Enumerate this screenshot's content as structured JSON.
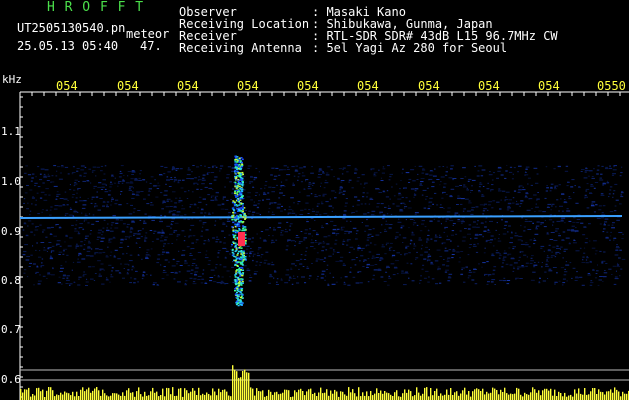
{
  "header": {
    "brand": "H R O F F T",
    "filename": "UT2505130540.pn",
    "tag": "meteor",
    "date": "25.05.13 05:40",
    "count": "47.",
    "fields": [
      {
        "label": "Observer",
        "value": ": Masaki Kano"
      },
      {
        "label": "Receiving Location",
        "value": ": Shibukawa, Gunma, Japan"
      },
      {
        "label": "Receiver",
        "value": ": RTL-SDR SDR# 43dB L15 96.7MHz CW"
      },
      {
        "label": "Receiving Antenna",
        "value": ": 5el Yagi Az 280 for Seoul"
      }
    ]
  },
  "axis": {
    "unit": "kHz",
    "y_ticks": [
      "1.1",
      "1.0",
      "0.9",
      "0.8",
      "0.7",
      "0.6"
    ],
    "time_labels": [
      "054",
      "054",
      "054",
      "054",
      "054",
      "054",
      "054",
      "054",
      "054",
      "0550"
    ]
  },
  "colors": {
    "background": "#000000",
    "header_text": "#ffffff",
    "brand": "#4be04b",
    "time_labels": "#ffff3a",
    "signal_line": "#3aa0ff",
    "meteor": "#ff3050",
    "meter": "#ffff3a"
  }
}
